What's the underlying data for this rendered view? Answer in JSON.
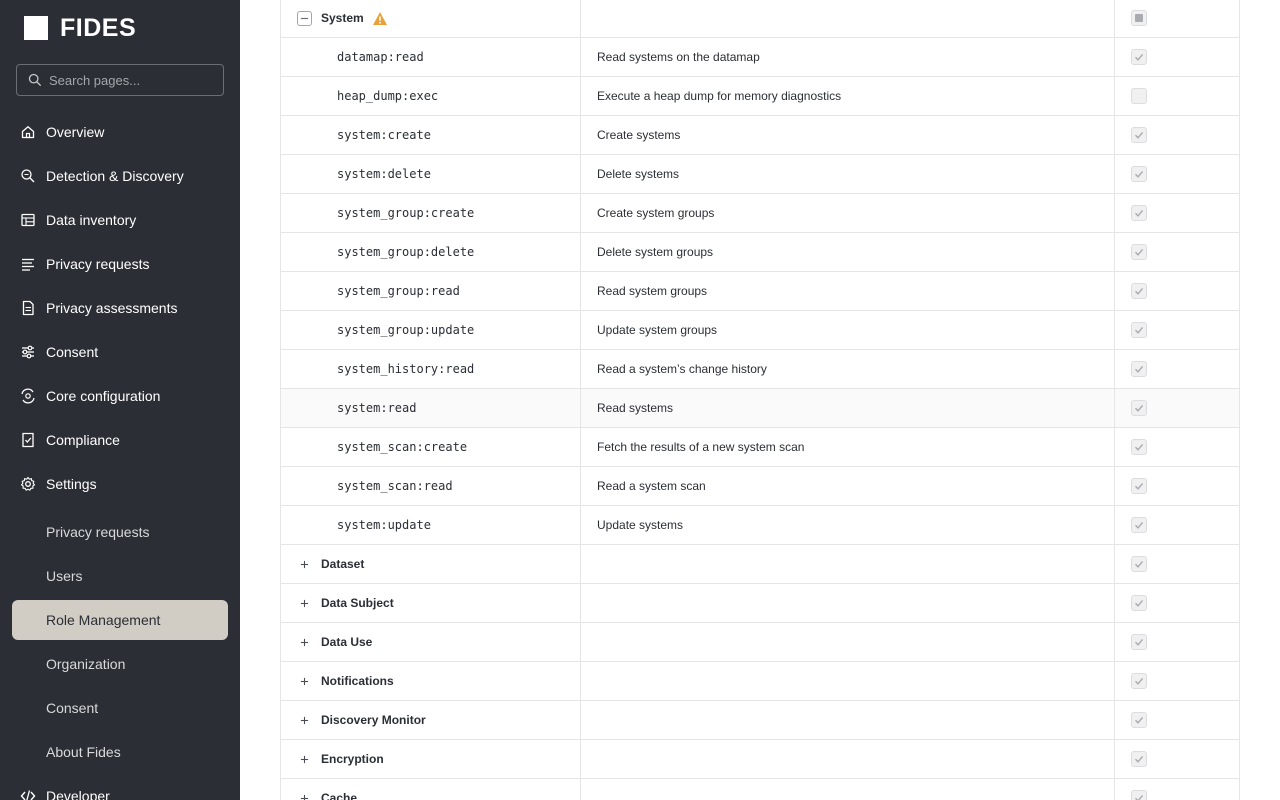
{
  "sidebar": {
    "brand": "FIDES",
    "search_placeholder": "Search pages...",
    "nav": [
      {
        "label": "Overview",
        "icon": "home-icon"
      },
      {
        "label": "Detection & Discovery",
        "icon": "discovery-search-icon"
      },
      {
        "label": "Data inventory",
        "icon": "inventory-table-icon"
      },
      {
        "label": "Privacy requests",
        "icon": "list-icon"
      },
      {
        "label": "Privacy assessments",
        "icon": "document-icon"
      },
      {
        "label": "Consent",
        "icon": "sliders-icon"
      },
      {
        "label": "Core configuration",
        "icon": "config-icon"
      },
      {
        "label": "Compliance",
        "icon": "compliance-icon"
      },
      {
        "label": "Settings",
        "icon": "gear-icon"
      }
    ],
    "settings_items": [
      {
        "label": "Privacy requests",
        "active": false
      },
      {
        "label": "Users",
        "active": false
      },
      {
        "label": "Role Management",
        "active": true
      },
      {
        "label": "Organization",
        "active": false
      },
      {
        "label": "Consent",
        "active": false
      },
      {
        "label": "About Fides",
        "active": false
      }
    ],
    "developer": {
      "label": "Developer",
      "icon": "code-icon"
    }
  },
  "permissions": {
    "expanded_group": {
      "name": "System",
      "state": "indeterminate",
      "warning_icon": "warning-icon",
      "rows": [
        {
          "code": "datamap:read",
          "description": "Read systems on the datamap",
          "checked": true
        },
        {
          "code": "heap_dump:exec",
          "description": "Execute a heap dump for memory diagnostics",
          "checked": false
        },
        {
          "code": "system:create",
          "description": "Create systems",
          "checked": true
        },
        {
          "code": "system:delete",
          "description": "Delete systems",
          "checked": true
        },
        {
          "code": "system_group:create",
          "description": "Create system groups",
          "checked": true
        },
        {
          "code": "system_group:delete",
          "description": "Delete system groups",
          "checked": true
        },
        {
          "code": "system_group:read",
          "description": "Read system groups",
          "checked": true
        },
        {
          "code": "system_group:update",
          "description": "Update system groups",
          "checked": true
        },
        {
          "code": "system_history:read",
          "description": "Read a system’s change history",
          "checked": true
        },
        {
          "code": "system:read",
          "description": "Read systems",
          "checked": true
        },
        {
          "code": "system_scan:create",
          "description": "Fetch the results of a new system scan",
          "checked": true
        },
        {
          "code": "system_scan:read",
          "description": "Read a system scan",
          "checked": true
        },
        {
          "code": "system:update",
          "description": "Update systems",
          "checked": true
        }
      ]
    },
    "collapsed_groups": [
      {
        "name": "Dataset",
        "checked": true
      },
      {
        "name": "Data Subject",
        "checked": true
      },
      {
        "name": "Data Use",
        "checked": true
      },
      {
        "name": "Notifications",
        "checked": true
      },
      {
        "name": "Discovery Monitor",
        "checked": true
      },
      {
        "name": "Encryption",
        "checked": true
      },
      {
        "name": "Cache",
        "checked": true
      }
    ]
  }
}
